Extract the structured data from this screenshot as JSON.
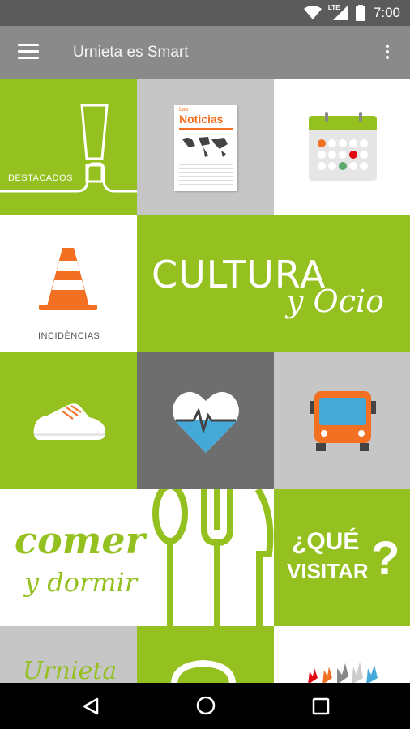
{
  "status": {
    "network": "LTE",
    "time": "7:00"
  },
  "appbar": {
    "title": "Urnieta es Smart",
    "menu_icon": "hamburger-icon",
    "more_icon": "more-vert-icon"
  },
  "tiles": {
    "destacados": {
      "label": "DESTACADOS"
    },
    "noticias": {
      "brand_small": "Las",
      "brand": "Noticias"
    },
    "incidencias": {
      "label": "INCIDÈNCIAS"
    },
    "cultura": {
      "line1": "CULTURA",
      "line2": "y Ocio"
    },
    "comer": {
      "line1": "comer",
      "line2": "y dormir"
    },
    "visitar": {
      "line1": "¿QUÉ",
      "line2": "VISITAR",
      "qmark": "?"
    },
    "urnieta": {
      "label": "Urnieta"
    }
  },
  "colors": {
    "green": "#94c11f",
    "orange": "#f36f21",
    "blue": "#45a9d8"
  }
}
